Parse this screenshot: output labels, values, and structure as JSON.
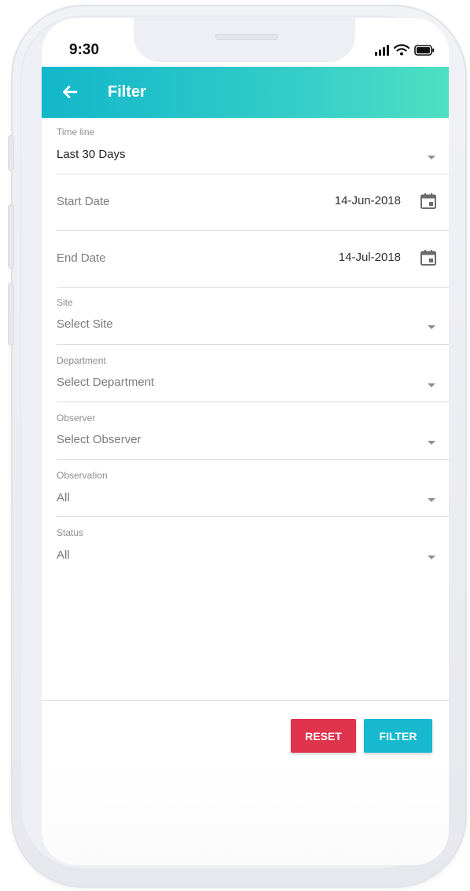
{
  "status_bar": {
    "time": "9:30"
  },
  "app_bar": {
    "title": "Filter"
  },
  "fields": {
    "timeline": {
      "label": "Time line",
      "value": "Last 30 Days"
    },
    "start_date": {
      "label": "Start Date",
      "value": "14-Jun-2018"
    },
    "end_date": {
      "label": "End Date",
      "value": "14-Jul-2018"
    },
    "site": {
      "label": "Site",
      "value": "Select Site"
    },
    "department": {
      "label": "Department",
      "value": "Select Department"
    },
    "observer": {
      "label": "Observer",
      "value": "Select Observer"
    },
    "observation": {
      "label": "Observation",
      "value": "All"
    },
    "status": {
      "label": "Status",
      "value": "All"
    }
  },
  "buttons": {
    "reset": "RESET",
    "filter": "FILTER"
  },
  "colors": {
    "app_bar_start": "#12b7c9",
    "app_bar_end": "#4ee0c3",
    "reset": "#e0334c",
    "filter": "#17b9ce"
  },
  "icons": {
    "back": "arrow-left-icon",
    "dropdown": "caret-down-icon",
    "calendar": "calendar-icon",
    "signal": "signal-icon",
    "wifi": "wifi-icon",
    "battery": "battery-icon"
  }
}
